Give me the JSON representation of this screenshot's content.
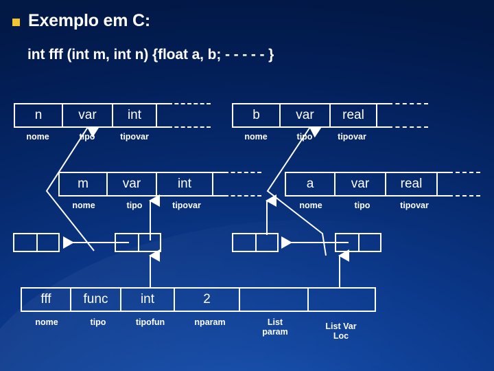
{
  "slide": {
    "bullet_icon": "square-bullet-icon",
    "title": "Exemplo em C:",
    "code": "int fff (int m, int n) {float a, b; - - - - - }",
    "accent_color": "#f2c431",
    "text_color": "#ffffff",
    "background_color": "#0b3788"
  },
  "records": [
    {
      "id": "record-n",
      "cells": [
        {
          "value": "n",
          "caption": "nome",
          "style": "solid"
        },
        {
          "value": "var",
          "caption": "tipo",
          "style": "solid"
        },
        {
          "value": "int",
          "caption": "tipovar",
          "style": "solid"
        },
        {
          "value": "",
          "caption": "",
          "style": "solid"
        },
        {
          "value": "",
          "caption": "",
          "style": "dashed"
        }
      ]
    },
    {
      "id": "record-b",
      "cells": [
        {
          "value": "b",
          "caption": "nome",
          "style": "solid"
        },
        {
          "value": "var",
          "caption": "tipo",
          "style": "solid"
        },
        {
          "value": "real",
          "caption": "tipovar",
          "style": "solid"
        },
        {
          "value": "",
          "caption": "",
          "style": "solid"
        },
        {
          "value": "",
          "caption": "",
          "style": "dashed"
        }
      ]
    },
    {
      "id": "record-m",
      "cells": [
        {
          "value": "m",
          "caption": "nome",
          "style": "solid"
        },
        {
          "value": "var",
          "caption": "tipo",
          "style": "solid"
        },
        {
          "value": "int",
          "caption": "tipovar",
          "style": "solid"
        },
        {
          "value": "",
          "caption": "",
          "style": "solid"
        },
        {
          "value": "",
          "caption": "",
          "style": "dashed"
        }
      ]
    },
    {
      "id": "record-a",
      "cells": [
        {
          "value": "a",
          "caption": "nome",
          "style": "solid"
        },
        {
          "value": "var",
          "caption": "tipo",
          "style": "solid"
        },
        {
          "value": "real",
          "caption": "tipovar",
          "style": "solid"
        },
        {
          "value": "",
          "caption": "",
          "style": "solid"
        },
        {
          "value": "",
          "caption": "",
          "style": "dashed"
        }
      ]
    },
    {
      "id": "record-fff",
      "cells": [
        {
          "value": "fff",
          "caption": "nome",
          "style": "solid"
        },
        {
          "value": "func",
          "caption": "tipo",
          "style": "solid"
        },
        {
          "value": "int",
          "caption": "tipofun",
          "style": "solid"
        },
        {
          "value": "2",
          "caption": "nparam",
          "style": "solid"
        },
        {
          "value": "",
          "caption": "List param",
          "style": "solid"
        },
        {
          "value": "",
          "caption": "List Var Loc",
          "style": "solid"
        }
      ]
    }
  ],
  "pointer_pairs": [
    {
      "id": "pointer-pair-left-1"
    },
    {
      "id": "pointer-pair-left-2"
    },
    {
      "id": "pointer-pair-right-1"
    },
    {
      "id": "pointer-pair-right-2"
    }
  ],
  "labels": {
    "nome": "nome",
    "tipo": "tipo",
    "tipovar": "tipovar",
    "tipofun": "tipofun",
    "nparam": "nparam",
    "list_param_line1": "List",
    "list_param_line2": "param",
    "list_var_loc_line1": "List Var",
    "list_var_loc_line2": "Loc"
  }
}
